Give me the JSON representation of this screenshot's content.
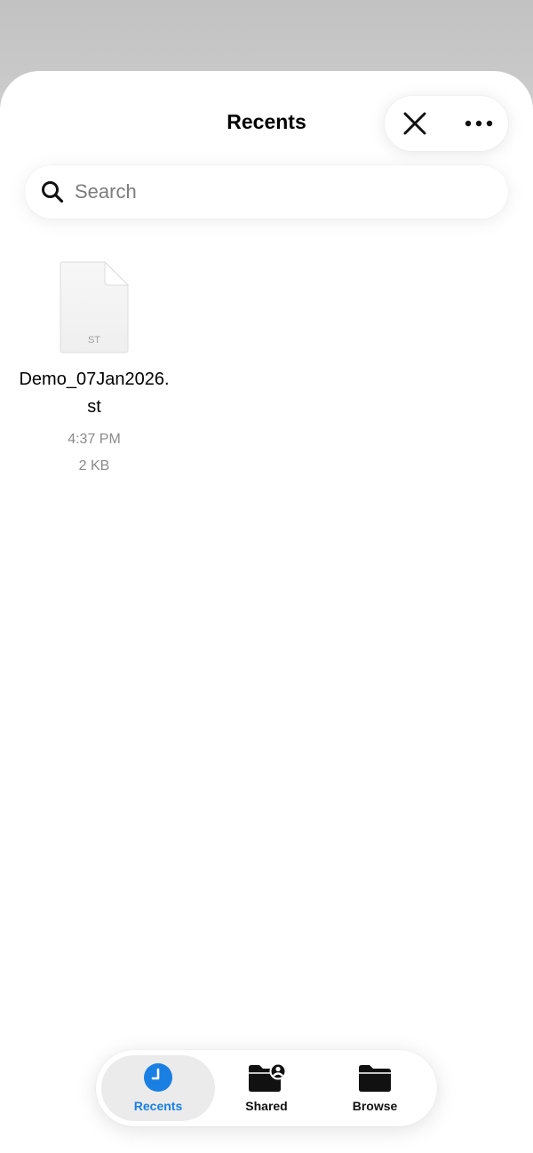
{
  "header": {
    "title": "Recents",
    "close_icon": "close-icon",
    "more_icon": "ellipsis-icon"
  },
  "search": {
    "placeholder": "Search",
    "value": ""
  },
  "files": [
    {
      "name": "Demo_07Jan2026.st",
      "extension": "ST",
      "time": "4:37 PM",
      "size": "2 KB",
      "icon": "document-icon"
    }
  ],
  "tabs": [
    {
      "label": "Recents",
      "icon": "clock-icon",
      "active": true
    },
    {
      "label": "Shared",
      "icon": "shared-folder-icon",
      "active": false
    },
    {
      "label": "Browse",
      "icon": "folder-icon",
      "active": false
    }
  ],
  "colors": {
    "accent": "#1a7fe3",
    "secondary_text": "#8a8a8a",
    "background": "#ffffff"
  }
}
